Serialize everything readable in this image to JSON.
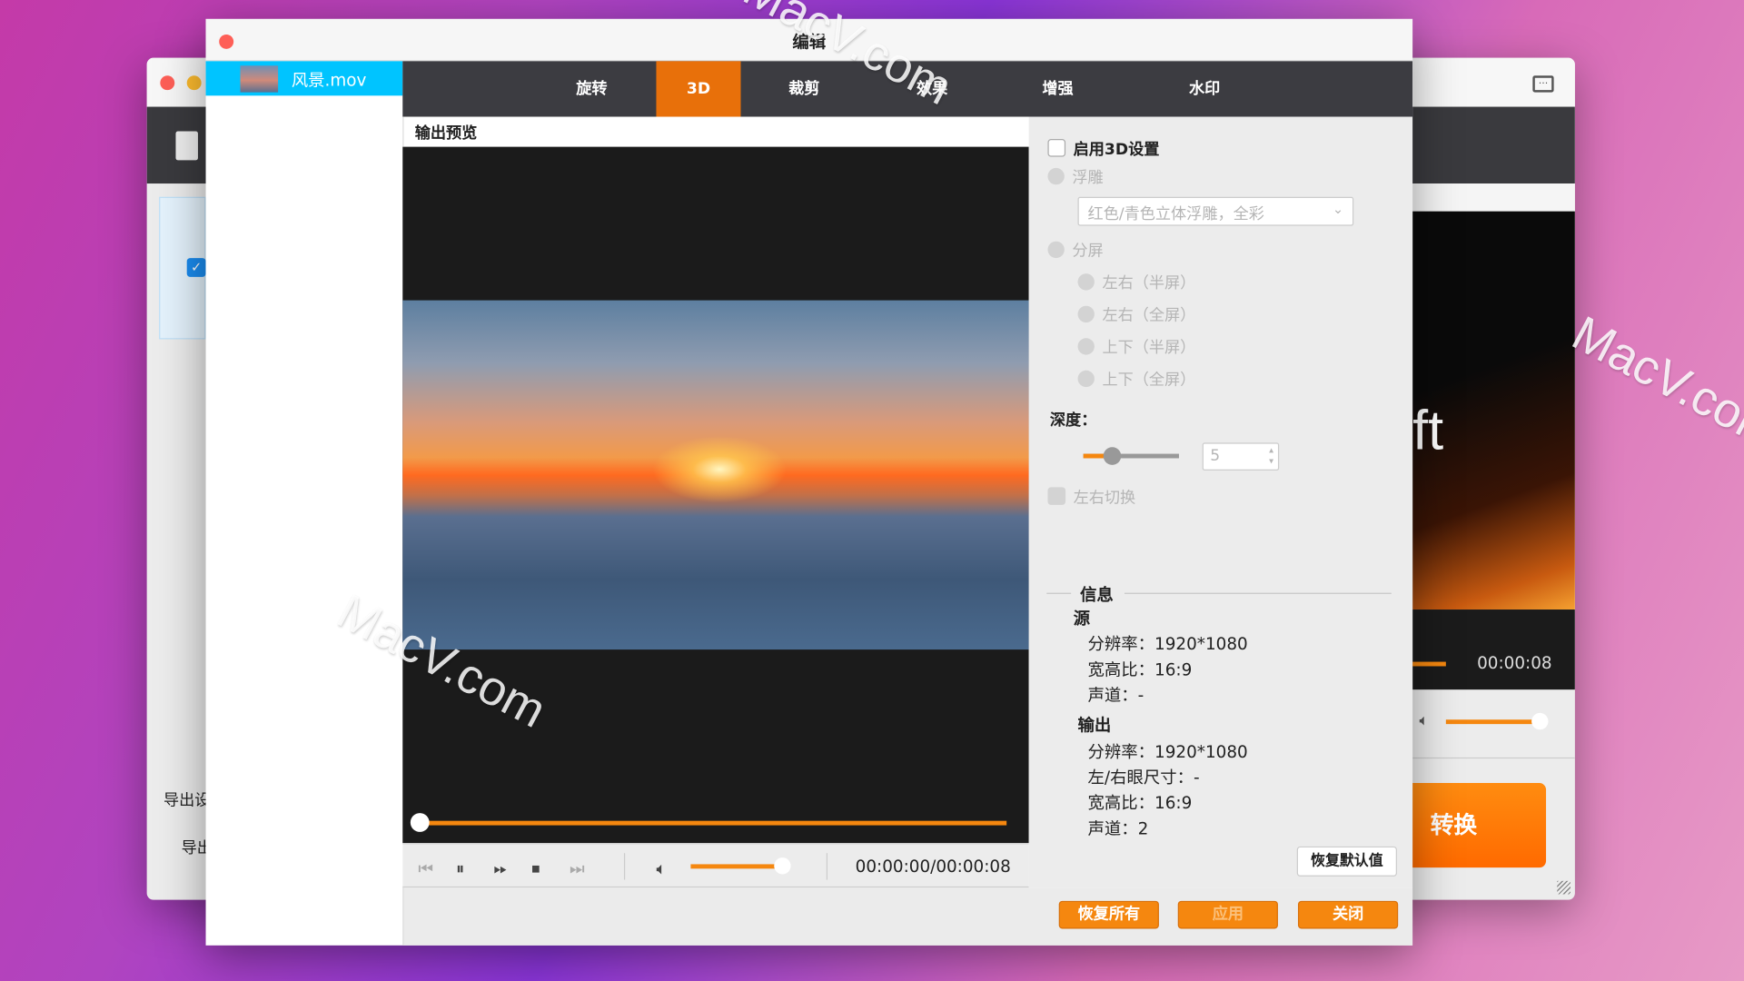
{
  "watermark": "MacV.com",
  "back_window": {
    "left_label_1": "导出设",
    "left_label_2": "导出",
    "preview_text": "ft",
    "time": "00:00:08",
    "convert_button": "转换",
    "volume_percent": 100
  },
  "edit_window": {
    "title": "编辑",
    "file_list": [
      {
        "name": "风景.mov",
        "selected": true
      }
    ],
    "tabs": [
      {
        "label": "旋转"
      },
      {
        "label": "3D",
        "active": true
      },
      {
        "label": "裁剪"
      },
      {
        "label": "效果"
      },
      {
        "label": "增强"
      },
      {
        "label": "水印"
      }
    ],
    "preview_label": "输出预览",
    "player": {
      "time": "00:00:00/00:00:08",
      "progress_percent": 0,
      "volume_percent": 100
    },
    "settings": {
      "enable_3d_label": "启用3D设置",
      "enable_3d_checked": false,
      "anaglyph_label": "浮雕",
      "anaglyph_select": "红色/青色立体浮雕，全彩",
      "split_label": "分屏",
      "split_options": [
        "左右（半屏）",
        "左右（全屏）",
        "上下（半屏）",
        "上下（全屏）"
      ],
      "depth_label": "深度：",
      "depth_value": "5",
      "swap_label": "左右切换"
    },
    "info": {
      "title": "信息",
      "source_label": "源",
      "source": [
        {
          "k": "分辨率：",
          "v": "1920*1080"
        },
        {
          "k": "宽高比：",
          "v": "16:9"
        },
        {
          "k": "声道：",
          "v": "-"
        }
      ],
      "output_label": "输出",
      "output": [
        {
          "k": "分辨率：",
          "v": "1920*1080"
        },
        {
          "k": "左/右眼尺寸：",
          "v": "-"
        },
        {
          "k": "宽高比：",
          "v": "16:9"
        },
        {
          "k": "声道：",
          "v": "2"
        }
      ]
    },
    "reset_default": "恢复默认值",
    "buttons": {
      "reset_all": "恢复所有",
      "apply": "应用",
      "close": "关闭"
    }
  },
  "colors": {
    "accent": "#f5870f",
    "tab_active": "#e8700a",
    "selection": "#00c4ff",
    "tabbar": "#3c3c41"
  }
}
